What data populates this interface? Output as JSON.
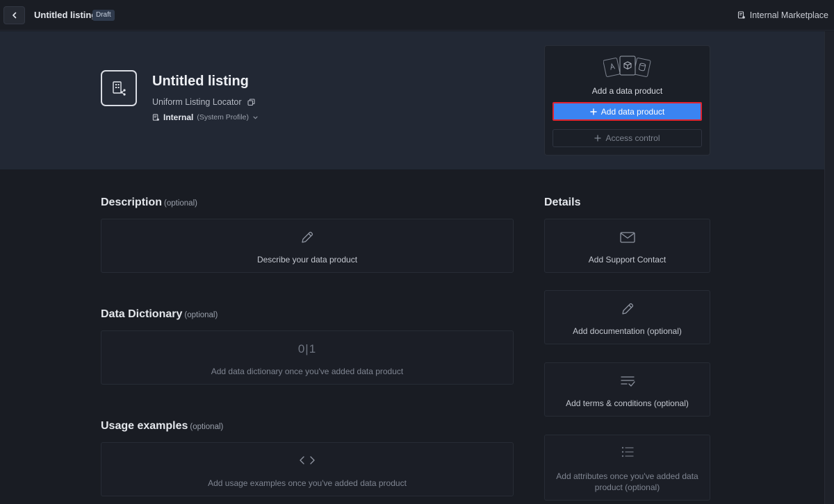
{
  "topbar": {
    "title": "Untitled listing",
    "badge": "Draft",
    "marketplace": "Internal Marketplace"
  },
  "listing": {
    "title": "Untitled listing",
    "locator": "Uniform Listing Locator",
    "profile_name": "Internal",
    "profile_sub": "(System Profile)"
  },
  "product_card": {
    "caption": "Add a data product",
    "add_button": "Add data product",
    "access_button": "Access control"
  },
  "sections": {
    "description": {
      "title": "Description",
      "optional": "(optional)",
      "prompt": "Describe your data product"
    },
    "dictionary": {
      "title": "Data Dictionary",
      "optional": "(optional)",
      "glyph": "0|1",
      "prompt": "Add data dictionary once you've added data product"
    },
    "usage": {
      "title": "Usage examples",
      "optional": "(optional)",
      "prompt": "Add usage examples once you've added data product"
    }
  },
  "details": {
    "title": "Details",
    "support": "Add Support Contact",
    "documentation": "Add documentation (optional)",
    "terms": "Add terms & conditions (optional)",
    "attributes": "Add attributes once you've added data product (optional)"
  },
  "colors": {
    "accent": "#3a84f2",
    "highlight": "#e0232e",
    "background": "#191c23",
    "hero": "#222834"
  }
}
